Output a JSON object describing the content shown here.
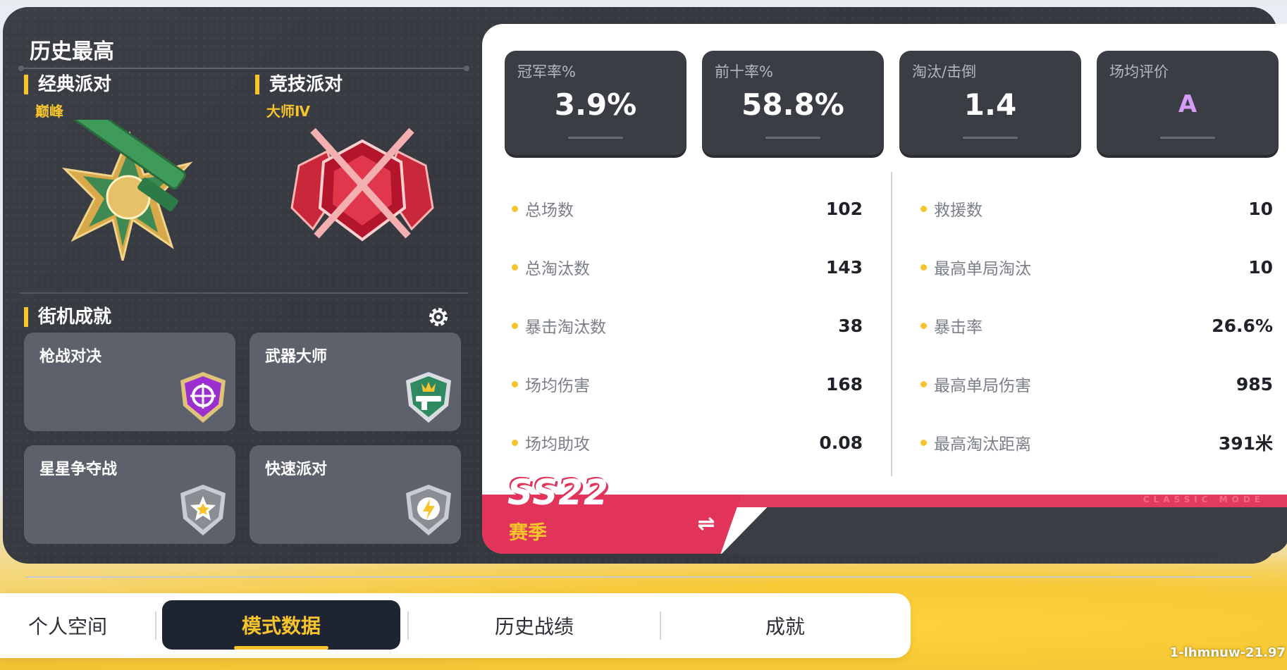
{
  "history": {
    "title": "历史最高",
    "classic": {
      "mode": "经典派对",
      "rank": "巅峰"
    },
    "competitive": {
      "mode": "竞技派对",
      "rank": "大师Ⅳ"
    }
  },
  "achievements": {
    "title": "街机成就",
    "cards": [
      {
        "name": "枪战对决",
        "badge_icon": "target-badge-icon",
        "color": "#9b2fd0"
      },
      {
        "name": "武器大师",
        "badge_icon": "weapon-crown-badge-icon",
        "color": "#2f8a62"
      },
      {
        "name": "星星争夺战",
        "badge_icon": "star-badge-icon",
        "color": "#8a8d94"
      },
      {
        "name": "快速派对",
        "badge_icon": "lightning-badge-icon",
        "color": "#8a8d94"
      }
    ]
  },
  "summary_cards": [
    {
      "label": "冠军率%",
      "value": "3.9%"
    },
    {
      "label": "前十率%",
      "value": "58.8%"
    },
    {
      "label": "淘汰/击倒",
      "value": "1.4"
    },
    {
      "label": "场均评价",
      "value": "A"
    }
  ],
  "stats_left": [
    {
      "label": "总场数",
      "value": "102"
    },
    {
      "label": "总淘汰数",
      "value": "143"
    },
    {
      "label": "暴击淘汰数",
      "value": "38"
    },
    {
      "label": "场均伤害",
      "value": "168"
    },
    {
      "label": "场均助攻",
      "value": "0.08"
    }
  ],
  "stats_right": [
    {
      "label": "救援数",
      "value": "10"
    },
    {
      "label": "最高单局淘汰",
      "value": "10"
    },
    {
      "label": "暴击率",
      "value": "26.6%"
    },
    {
      "label": "最高单局伤害",
      "value": "985"
    },
    {
      "label": "最高淘汰距离",
      "value": "391米"
    }
  ],
  "season": {
    "code": "SS22",
    "word": "赛季",
    "mode_caption": "CLASSIC MODE",
    "swap_icon": "swap-arrows-icon"
  },
  "nav": {
    "items": [
      "个人空间",
      "模式数据",
      "历史战绩",
      "成就"
    ],
    "active": "模式数据"
  },
  "version": "1-lhmnuw-21.97",
  "colors": {
    "accent_yellow": "#f7c42b",
    "season_red": "#e2345a",
    "panel_dark": "#3a3d44",
    "grade_purple": "#d49cf7"
  }
}
